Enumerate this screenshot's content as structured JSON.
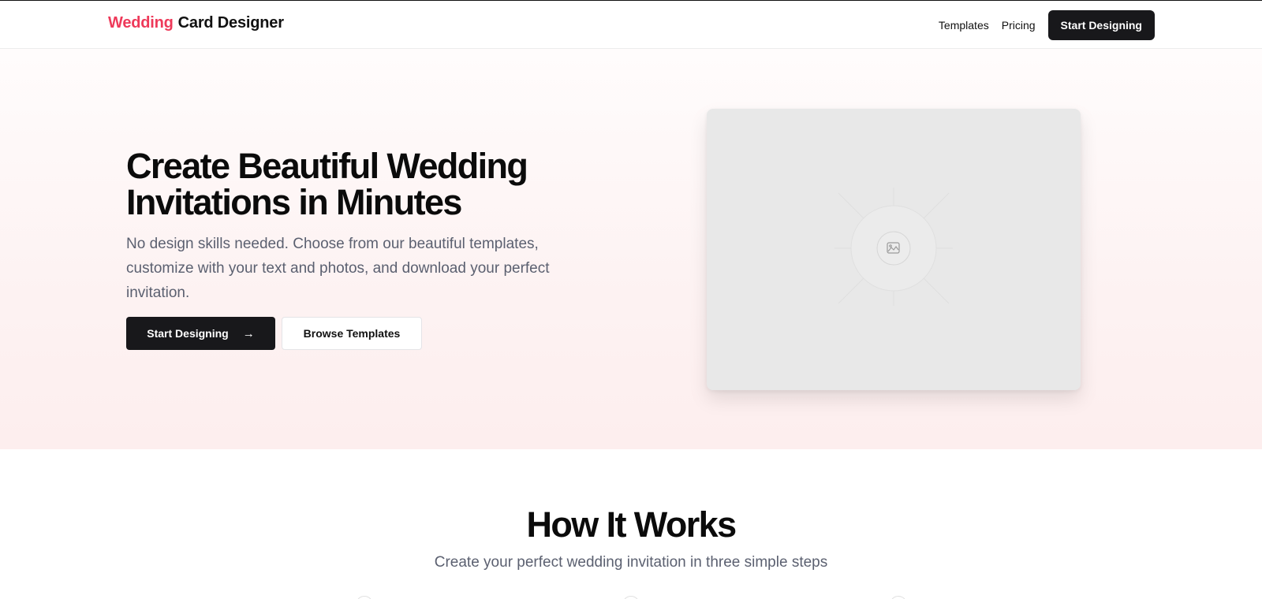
{
  "header": {
    "brand_accent": "Wedding",
    "brand_rest": "Card Designer",
    "nav": {
      "templates": "Templates",
      "pricing": "Pricing",
      "cta": "Start Designing"
    }
  },
  "hero": {
    "title": "Create Beautiful Wedding Invitations in Minutes",
    "subtitle": "No design skills needed. Choose from our beautiful templates, customize with your text and photos, and download your perfect invitation.",
    "primary_button": "Start Designing",
    "primary_button_icon": "arrow-right-icon",
    "secondary_button": "Browse Templates",
    "preview_icon": "image-placeholder-icon"
  },
  "how_it_works": {
    "title": "How It Works",
    "subtitle": "Create your perfect wedding invitation in three simple steps"
  },
  "colors": {
    "accent": "#ee3a5a",
    "primary_button": "#18181b",
    "muted_text": "#5b6070"
  }
}
